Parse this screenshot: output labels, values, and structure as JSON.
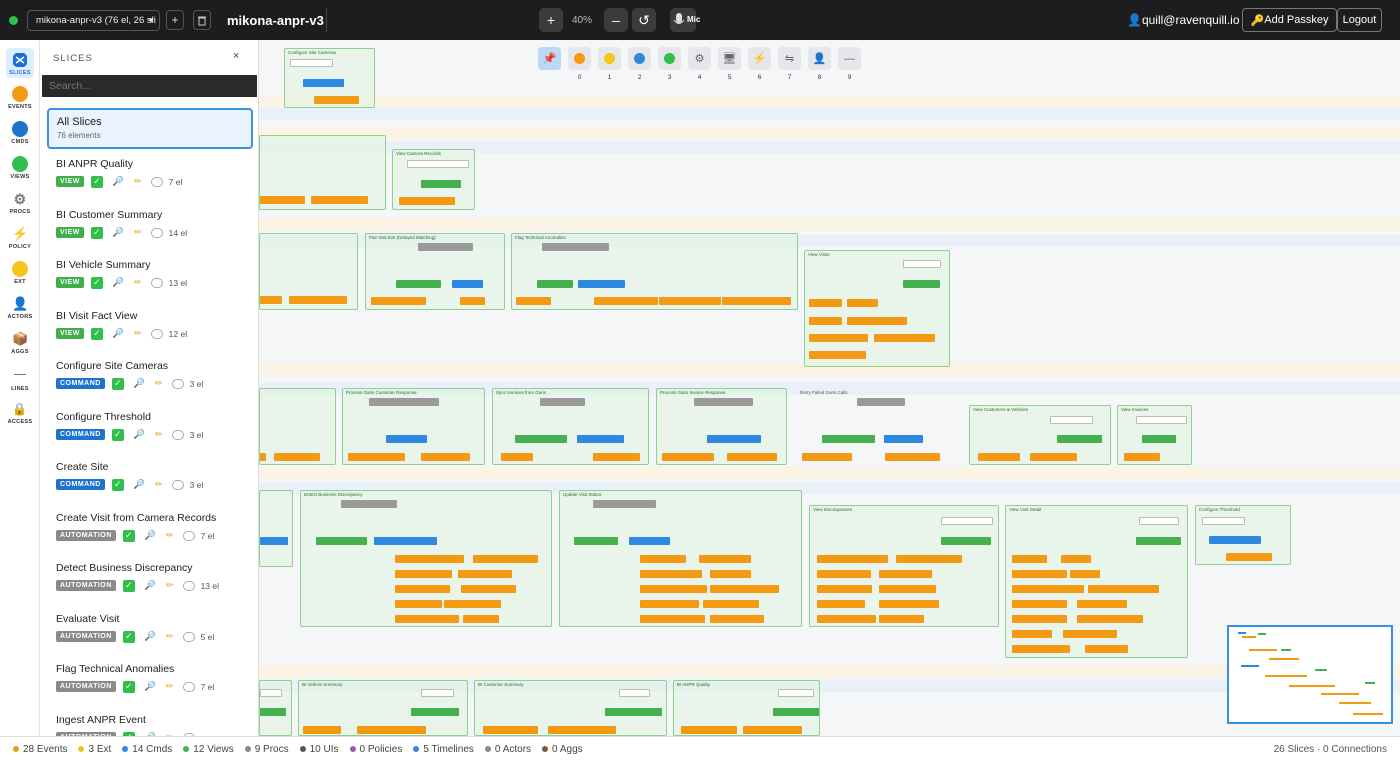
{
  "header": {
    "board_select": "mikona-anpr-v3 (76 el, 26 sli",
    "title": "mikona-anpr-v3",
    "zoom": "40%",
    "mic": "Mic",
    "user": "quill@ravenquill.io",
    "passkey": "Add Passkey",
    "logout": "Logout",
    "plus": "+",
    "minus": "–",
    "reset": "↺"
  },
  "rail": [
    {
      "label": "SLICES",
      "icon": "slices-icon"
    },
    {
      "label": "EVENTS",
      "icon": "events-icon",
      "color": "#f39a14"
    },
    {
      "label": "CMDS",
      "icon": "cmds-icon",
      "color": "#1c74cc"
    },
    {
      "label": "VIEWS",
      "icon": "views-icon",
      "color": "#2fbf4a"
    },
    {
      "label": "PROCS",
      "icon": "gear-icon"
    },
    {
      "label": "POLICY",
      "icon": "bolt-icon"
    },
    {
      "label": "EXT",
      "icon": "ext-icon",
      "color": "#f5c518"
    },
    {
      "label": "ACTORS",
      "icon": "actor-icon"
    },
    {
      "label": "AGGS",
      "icon": "box-icon"
    },
    {
      "label": "LINES",
      "icon": "lines-icon"
    },
    {
      "label": "ACCESS",
      "icon": "lock-icon"
    }
  ],
  "panel": {
    "heading": "SLICES",
    "close": "×",
    "search_placeholder": "Search...",
    "all": {
      "title": "All Slices",
      "subtitle": "76 elements"
    },
    "slices": [
      {
        "name": "BI ANPR Quality",
        "type": "VIEW",
        "count": "7 el"
      },
      {
        "name": "BI Customer Summary",
        "type": "VIEW",
        "count": "14 el"
      },
      {
        "name": "BI Vehicle Summary",
        "type": "VIEW",
        "count": "13 el"
      },
      {
        "name": "BI Visit Fact View",
        "type": "VIEW",
        "count": "12 el"
      },
      {
        "name": "Configure Site Cameras",
        "type": "COMMAND",
        "count": "3 el"
      },
      {
        "name": "Configure Threshold",
        "type": "COMMAND",
        "count": "3 el"
      },
      {
        "name": "Create Site",
        "type": "COMMAND",
        "count": "3 el"
      },
      {
        "name": "Create Visit from Camera Records",
        "type": "AUTOMATION",
        "count": "7 el"
      },
      {
        "name": "Detect Business Discrepancy",
        "type": "AUTOMATION",
        "count": "13 el"
      },
      {
        "name": "Evaluate Visit",
        "type": "AUTOMATION",
        "count": "5 el"
      },
      {
        "name": "Flag Technical Anomalies",
        "type": "AUTOMATION",
        "count": "7 el"
      },
      {
        "name": "Ingest ANPR Event",
        "type": "AUTOMATION",
        "count": ""
      }
    ]
  },
  "toolbar": {
    "numbers": [
      "0",
      "1",
      "2",
      "3",
      "4",
      "5",
      "6",
      "7",
      "8",
      "9"
    ]
  },
  "canvas": {
    "slices": [
      {
        "title": "Configure Site Cameras"
      },
      {
        "title": "View Camera Records"
      },
      {
        "title": "Pair Visit Exit (Delayed Matching)"
      },
      {
        "title": "Flag Technical Anomalies"
      },
      {
        "title": "View Visits"
      },
      {
        "title": "Process Garis Customer Response"
      },
      {
        "title": "Sync Invoices from Garis"
      },
      {
        "title": "Process Garis Invoice Response"
      },
      {
        "title": "Retry Failed Garis Calls"
      },
      {
        "title": "View Customers & Vehicles"
      },
      {
        "title": "View Invoices"
      },
      {
        "title": "Detect Business Discrepancy"
      },
      {
        "title": "Update Visit Status"
      },
      {
        "title": "View Discrepancies"
      },
      {
        "title": "View Visit Detail"
      },
      {
        "title": "Configure Threshold"
      },
      {
        "title": "BI Vehicle Summary"
      },
      {
        "title": "BI Customer Summary"
      },
      {
        "title": "BI ANPR Quality"
      }
    ]
  },
  "status": {
    "items": [
      {
        "label": "28 Events",
        "color": "#f39a14"
      },
      {
        "label": "3 Ext",
        "color": "#f5c518"
      },
      {
        "label": "14 Cmds",
        "color": "#2f88e0"
      },
      {
        "label": "12 Views",
        "color": "#45b04d"
      },
      {
        "label": "9 Procs",
        "color": "#888888"
      },
      {
        "label": "10 UIs",
        "color": "#555555"
      },
      {
        "label": "0 Policies",
        "color": "#9b59b6"
      },
      {
        "label": "5 Timelines",
        "color": "#2f88e0"
      },
      {
        "label": "0 Actors",
        "color": "#888888"
      },
      {
        "label": "0 Aggs",
        "color": "#7a5a3a"
      }
    ],
    "right": "26 Slices · 0 Connections"
  }
}
